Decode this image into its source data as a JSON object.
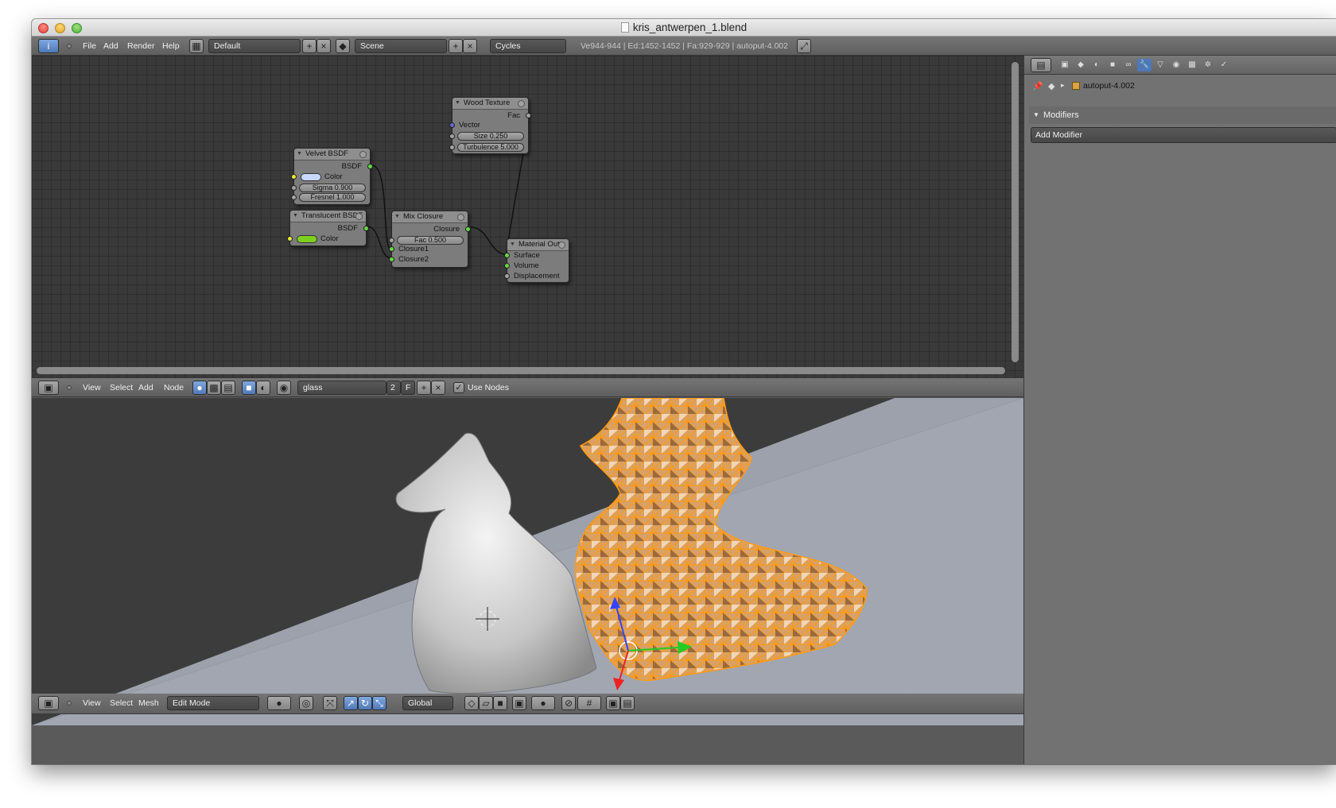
{
  "window": {
    "title": "kris_antwerpen_1.blend"
  },
  "info_header": {
    "menus": [
      "File",
      "Add",
      "Render",
      "Help"
    ],
    "screen_layout": "Default",
    "scene": "Scene",
    "render_engine": "Cycles",
    "stats": "Ve944-944 | Ed:1452-1452 | Fa:929-929 | autoput-4.002"
  },
  "nodes": {
    "wood": {
      "title": "Wood Texture",
      "out_fac": "Fac",
      "in_vector": "Vector",
      "size": "Size 0.250",
      "turbulence": "Turbulence 5.000"
    },
    "velvet": {
      "title": "Velvet BSDF",
      "out": "BSDF",
      "color": "Color",
      "sigma": "Sigma 0.900",
      "fresnel": "Fresnel 1.000"
    },
    "translucent": {
      "title": "Translucent BSDF",
      "out": "BSDF",
      "color": "Color"
    },
    "mix": {
      "title": "Mix Closure",
      "out": "Closure",
      "fac": "Fac 0.500",
      "in1": "Closure1",
      "in2": "Closure2"
    },
    "output": {
      "title": "Material Out",
      "surface": "Surface",
      "volume": "Volume",
      "displacement": "Displacement"
    }
  },
  "node_header": {
    "menus": [
      "View",
      "Select",
      "Add",
      "Node"
    ],
    "material": "glass",
    "users": "2",
    "fake": "F",
    "use_nodes": "Use Nodes"
  },
  "viewport_header": {
    "menus": [
      "View",
      "Select",
      "Mesh"
    ],
    "mode": "Edit Mode",
    "orientation": "Global"
  },
  "properties": {
    "object": "autoput-4.002",
    "panel": "Modifiers",
    "add_modifier": "Add Modifier"
  },
  "colors": {
    "selection": "#f5a623",
    "velvet_color": "#c9d6ff",
    "translucent_color": "#7ccf1f",
    "active_tab": "#4f78b8"
  }
}
